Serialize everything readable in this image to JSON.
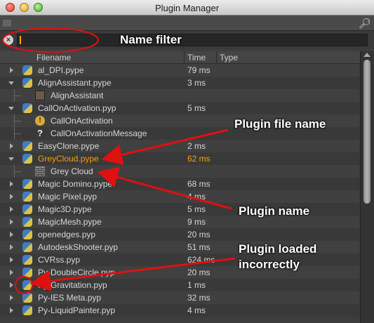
{
  "window": {
    "title": "Plugin Manager"
  },
  "filter": {
    "value": "",
    "placeholder": ""
  },
  "columns": {
    "filename": "Filename",
    "time": "Time",
    "type": "Type"
  },
  "rows": [
    {
      "name": "al_DPI.pype",
      "time": "79 ms",
      "icon": "python-icon",
      "expander": "collapsed",
      "level": 0
    },
    {
      "name": "AlignAssistant.pype",
      "time": "3 ms",
      "icon": "python-icon",
      "expander": "expanded",
      "level": 0
    },
    {
      "name": "AlignAssistant",
      "time": "",
      "icon": "command-icon",
      "expander": "none",
      "level": 1
    },
    {
      "name": "CallOnActivation.pyp",
      "time": "5 ms",
      "icon": "python-icon",
      "expander": "expanded",
      "level": 0
    },
    {
      "name": "CallOnActivation",
      "time": "",
      "icon": "warning-icon",
      "expander": "none",
      "level": 1
    },
    {
      "name": "CallOnActivationMessage",
      "time": "",
      "icon": "question-icon",
      "expander": "none",
      "level": 1
    },
    {
      "name": "EasyClone.pype",
      "time": "2 ms",
      "icon": "python-icon",
      "expander": "collapsed",
      "level": 0
    },
    {
      "name": "GreyCloud.pype",
      "time": "62 ms",
      "icon": "python-icon",
      "expander": "expanded",
      "level": 0,
      "highlight": true
    },
    {
      "name": "Grey Cloud",
      "time": "",
      "icon": "noise-icon",
      "expander": "none",
      "level": 1
    },
    {
      "name": "Magic Domino.pype",
      "time": "68 ms",
      "icon": "python-icon",
      "expander": "collapsed",
      "level": 0
    },
    {
      "name": "Magic Pixel.pyp",
      "time": "4 ms",
      "icon": "python-icon",
      "expander": "collapsed",
      "level": 0
    },
    {
      "name": "Magic3D.pype",
      "time": "5 ms",
      "icon": "python-icon",
      "expander": "collapsed",
      "level": 0
    },
    {
      "name": "MagicMesh.pype",
      "time": "9 ms",
      "icon": "python-icon",
      "expander": "collapsed",
      "level": 0
    },
    {
      "name": "openedges.pyp",
      "time": "20 ms",
      "icon": "python-icon",
      "expander": "collapsed",
      "level": 0
    },
    {
      "name": "AutodeskShooter.pyp",
      "time": "51 ms",
      "icon": "python-icon",
      "expander": "collapsed",
      "level": 0
    },
    {
      "name": "CVRss.pyp",
      "time": "624 ms",
      "icon": "python-icon",
      "expander": "collapsed",
      "level": 0
    },
    {
      "name": "Py-DoubleCircle.pyp",
      "time": "20 ms",
      "icon": "python-icon",
      "expander": "collapsed",
      "level": 0
    },
    {
      "name": "Py-Gravitation.pyp",
      "time": "1 ms",
      "icon": "python-icon",
      "expander": "collapsed",
      "level": 0,
      "error": true
    },
    {
      "name": "Py-IES Meta.pyp",
      "time": "32 ms",
      "icon": "python-icon",
      "expander": "collapsed",
      "level": 0
    },
    {
      "name": "Py-LiquidPainter.pyp",
      "time": "4 ms",
      "icon": "python-icon",
      "expander": "collapsed",
      "level": 0
    }
  ],
  "annotations": {
    "name_filter": "Name filter",
    "plugin_file_name": "Plugin file name",
    "plugin_name": "Plugin name",
    "plugin_loaded_incorrectly_1": "Plugin loaded",
    "plugin_loaded_incorrectly_2": "incorrectly"
  },
  "colors": {
    "annotation": "#e01010",
    "highlight": "#f5a200",
    "background": "#3d3d3d"
  }
}
